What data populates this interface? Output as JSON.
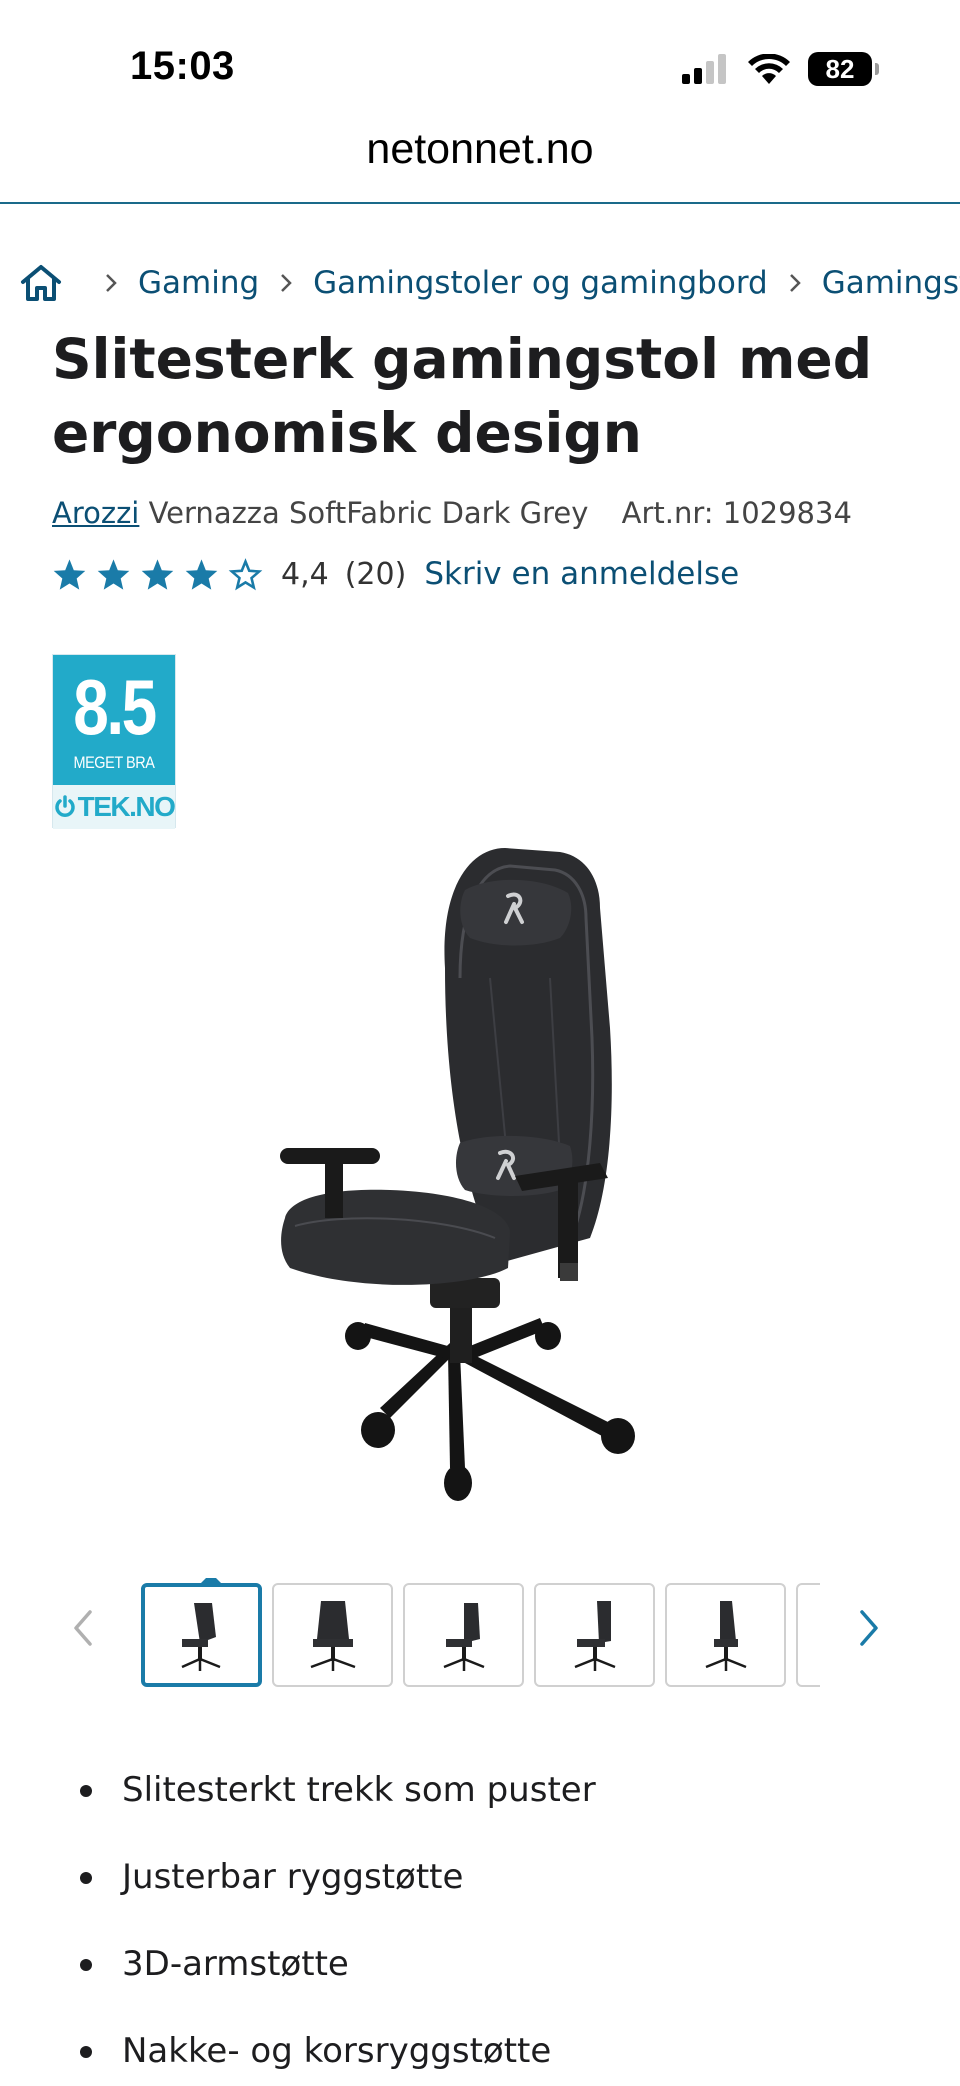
{
  "status_bar": {
    "time": "15:03",
    "battery": "82"
  },
  "browser": {
    "url": "netonnet.no"
  },
  "breadcrumb": {
    "home_icon": "home-icon",
    "items": [
      {
        "label": "Gaming"
      },
      {
        "label": "Gamingstoler og gamingbord"
      },
      {
        "label": "Gamingsto"
      }
    ]
  },
  "product": {
    "title": "Slitesterk gamingstol med ergonomisk design",
    "brand": "Arozzi",
    "model": "Vernazza SoftFabric Dark Grey",
    "article_number": "Art.nr: 1029834",
    "rating": {
      "stars_value": 4.4,
      "value_text": "4,4",
      "count_text": "(20)",
      "review_link": "Skriv en anmeldelse"
    },
    "badge": {
      "score": "8.5",
      "label": "MEGET BRA",
      "source": "TEK.NO"
    },
    "thumbnails_visible": 6,
    "active_thumbnail": 1,
    "features": [
      "Slitesterkt trekk som puster",
      "Justerbar ryggstøtte",
      "3D-armstøtte",
      "Nakke- og korsryggstøtte"
    ]
  },
  "colors": {
    "link": "#0b4f74",
    "star": "#1a7ba8",
    "badge": "#22aac9"
  }
}
